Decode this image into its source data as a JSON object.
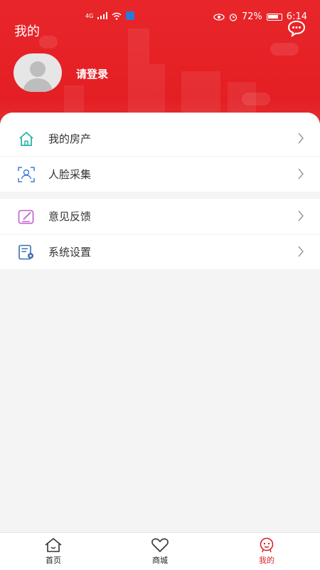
{
  "status_bar": {
    "network": "4G",
    "battery": "72%",
    "time": "6:14"
  },
  "header": {
    "title": "我的",
    "login_text": "请登录"
  },
  "menu": {
    "group1": [
      {
        "label": "我的房产",
        "icon": "home-icon"
      },
      {
        "label": "人脸采集",
        "icon": "face-scan-icon"
      }
    ],
    "group2": [
      {
        "label": "意见反馈",
        "icon": "feedback-edit-icon"
      },
      {
        "label": "系统设置",
        "icon": "settings-doc-icon"
      }
    ]
  },
  "tabbar": [
    {
      "label": "首页",
      "icon": "home-icon",
      "active": false
    },
    {
      "label": "商城",
      "icon": "heart-icon",
      "active": false
    },
    {
      "label": "我的",
      "icon": "profile-face-icon",
      "active": true
    }
  ],
  "colors": {
    "brand": "#e41f24",
    "teal": "#26b5a8",
    "blue": "#3b7fd6",
    "purple": "#c65ad6",
    "active_tab": "#d8242b"
  }
}
